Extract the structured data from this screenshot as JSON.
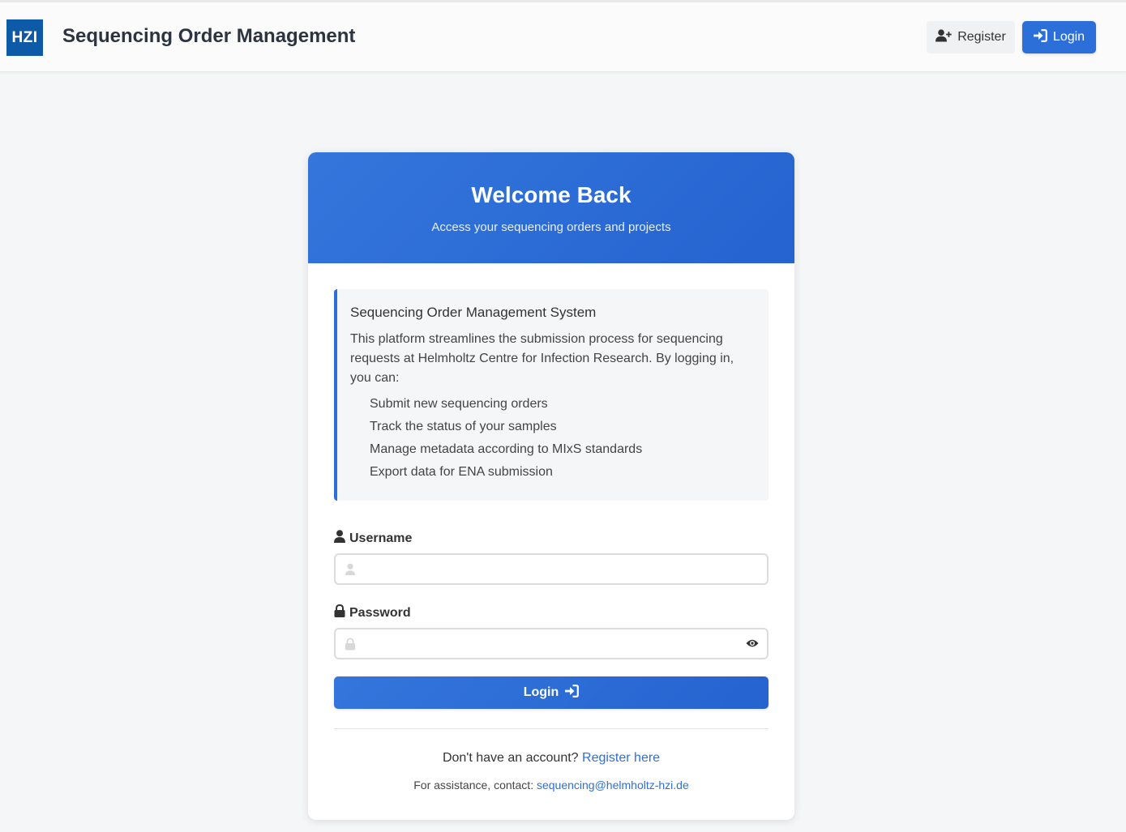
{
  "header": {
    "logo_text": "HZI",
    "title": "Sequencing Order Management",
    "register_label": "Register",
    "login_label": "Login",
    "accent_color": "#2d6fd9"
  },
  "card": {
    "title": "Welcome Back",
    "subtitle": "Access your sequencing orders and projects"
  },
  "info": {
    "title": "Sequencing Order Management System",
    "description": "This platform streamlines the submission process for sequencing requests at Helmholtz Centre for Infection Research. By logging in, you can:",
    "items": [
      "Submit new sequencing orders",
      "Track the status of your samples",
      "Manage metadata according to MIxS standards",
      "Export data for ENA submission"
    ]
  },
  "form": {
    "username_label": "Username",
    "username_value": "",
    "password_label": "Password",
    "password_value": "",
    "submit_label": "Login"
  },
  "footer": {
    "no_account_text": "Don't have an account?",
    "register_link": "Register here",
    "contact_text": "For assistance, contact:",
    "contact_email": "sequencing@helmholtz-hzi.de"
  },
  "icons": [
    "user-plus-icon",
    "sign-in-icon",
    "user-icon",
    "lock-icon",
    "eye-icon"
  ]
}
